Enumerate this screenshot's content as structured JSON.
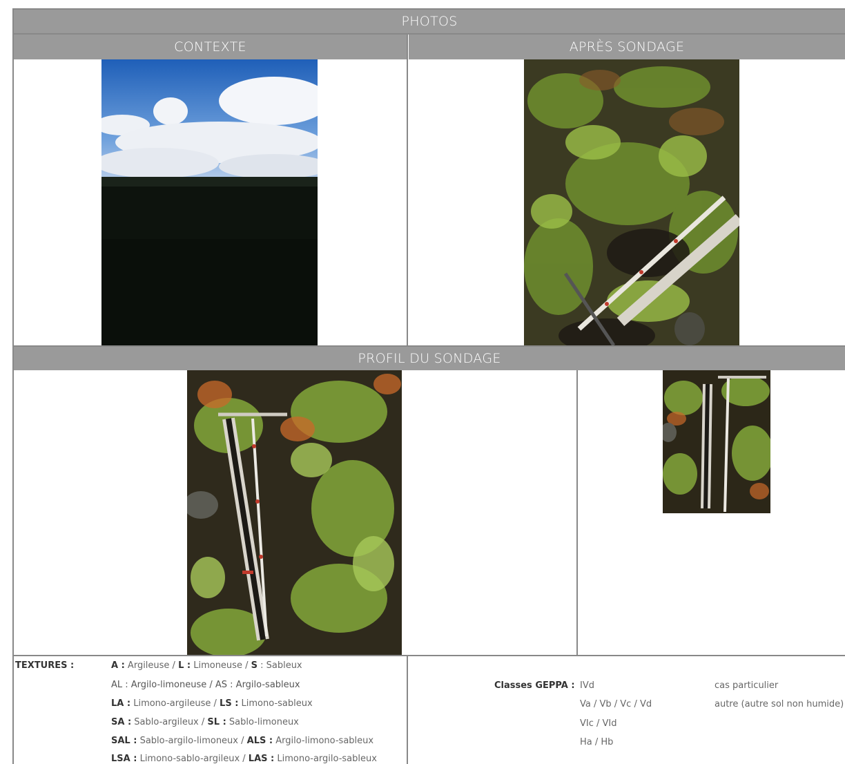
{
  "header": {
    "photos": "PHOTOS",
    "contexte": "CONTEXTE",
    "apres_sondage": "APRÈS SONDAGE",
    "profil": "PROFIL DU SONDAGE"
  },
  "photos": [
    {
      "name": "contexte-photo",
      "desc": "sky-field"
    },
    {
      "name": "apres-sondage-photo",
      "desc": "ferns-auger"
    },
    {
      "name": "profil-photo-main",
      "desc": "ferns-core"
    },
    {
      "name": "profil-photo-small",
      "desc": "core-closeup"
    }
  ],
  "textures": {
    "label": "TEXTURES :",
    "rows": [
      {
        "k1": "A :",
        "v1": " Argileuse / ",
        "k2": "L :",
        "v2": " Limoneuse / ",
        "k3": "S",
        "v3": " : Sableux"
      },
      {
        "k1": "",
        "v1": "AL : Argilo-limoneuse / AS : Argilo-sableux",
        "k2": "",
        "v2": "",
        "k3": "",
        "v3": ""
      },
      {
        "k1": "LA :",
        "v1": " Limono-argileuse / ",
        "k2": "LS :",
        "v2": " Limono-sableux",
        "k3": "",
        "v3": ""
      },
      {
        "k1": "SA :",
        "v1": " Sablo-argileux / ",
        "k2": "SL :",
        "v2": " Sablo-limoneux",
        "k3": "",
        "v3": ""
      },
      {
        "k1": "SAL :",
        "v1": " Sablo-argilo-limoneux  / ",
        "k2": "ALS :",
        "v2": " Argilo-limono-sableux",
        "k3": "",
        "v3": ""
      },
      {
        "k1": "LSA :",
        "v1": " Limono-sablo-argileux /  ",
        "k2": "LAS :",
        "v2": " Limono-argilo-sableux",
        "k3": "",
        "v3": ""
      }
    ]
  },
  "geppa": {
    "label": "Classes GEPPA :",
    "classes": [
      "IVd",
      "Va / Vb / Vc / Vd",
      "VIc / VId",
      "Ha / Hb"
    ],
    "other": [
      "cas particulier",
      "autre (autre sol non humide)"
    ]
  },
  "colors": {
    "header_bg": "#9a9a9a",
    "border": "#888888"
  }
}
